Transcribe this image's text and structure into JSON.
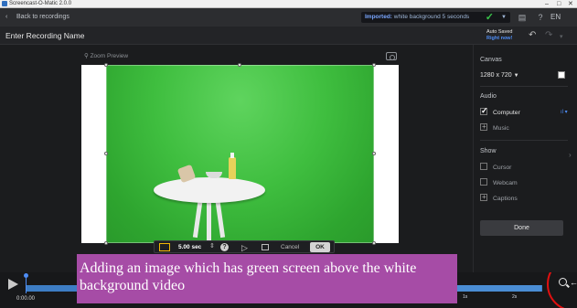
{
  "window": {
    "title": "Screencast-O-Matic  2.0.0",
    "controls": [
      "–",
      "□",
      "✕"
    ]
  },
  "toolbar": {
    "back_label": "Back to recordings",
    "imported_prefix": "Imported:",
    "imported_name": "white background 5 seconds",
    "language": "EN"
  },
  "header": {
    "recording_name": "Enter Recording Name",
    "autosave_line1": "Auto Saved",
    "autosave_line2": "Right now!"
  },
  "preview": {
    "zoom_label": "Zoom Preview"
  },
  "overlay_controls": {
    "duration": "5.00 sec",
    "help": "?",
    "cancel_label": "Cancel",
    "ok_label": "OK"
  },
  "timeline": {
    "timecode": "0:00.00",
    "ticks": [
      "1s",
      "2s"
    ]
  },
  "right_panel": {
    "canvas_title": "Canvas",
    "canvas_size": "1280 x 720",
    "audio_title": "Audio",
    "audio_items": [
      {
        "label": "Computer",
        "checked": true
      },
      {
        "label": "Music",
        "checked": false
      }
    ],
    "show_title": "Show",
    "show_items": [
      {
        "label": "Cursor"
      },
      {
        "label": "Webcam"
      },
      {
        "label": "Captions"
      }
    ],
    "done_label": "Done"
  },
  "caption": {
    "text": "Adding an image which has green screen above the white background video"
  },
  "colors": {
    "accent": "#4e8df5",
    "green_screen": "#3fbe3f",
    "caption_bg": "#a64ca6",
    "annotation_ring": "#e01010"
  }
}
